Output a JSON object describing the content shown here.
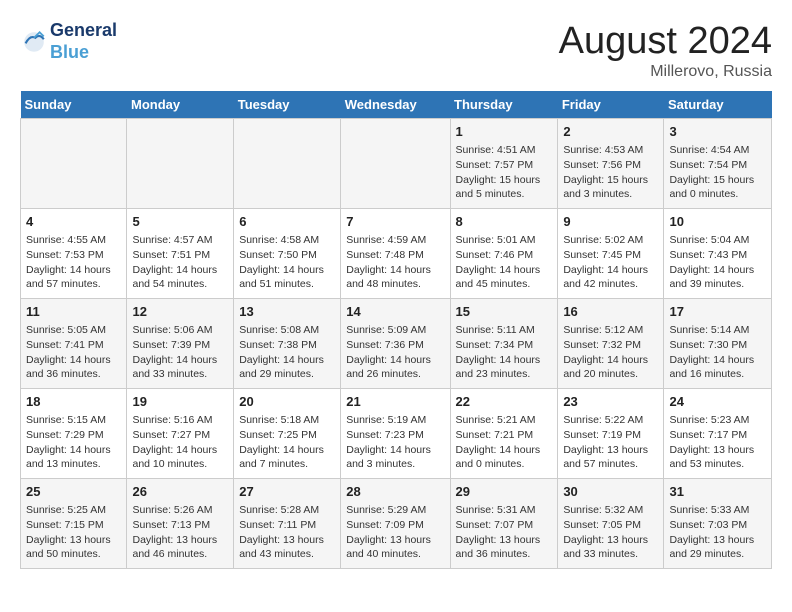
{
  "header": {
    "logo_line1": "General",
    "logo_line2": "Blue",
    "month_year": "August 2024",
    "location": "Millerovo, Russia"
  },
  "weekdays": [
    "Sunday",
    "Monday",
    "Tuesday",
    "Wednesday",
    "Thursday",
    "Friday",
    "Saturday"
  ],
  "weeks": [
    [
      {
        "day": "",
        "info": ""
      },
      {
        "day": "",
        "info": ""
      },
      {
        "day": "",
        "info": ""
      },
      {
        "day": "",
        "info": ""
      },
      {
        "day": "1",
        "info": "Sunrise: 4:51 AM\nSunset: 7:57 PM\nDaylight: 15 hours\nand 5 minutes."
      },
      {
        "day": "2",
        "info": "Sunrise: 4:53 AM\nSunset: 7:56 PM\nDaylight: 15 hours\nand 3 minutes."
      },
      {
        "day": "3",
        "info": "Sunrise: 4:54 AM\nSunset: 7:54 PM\nDaylight: 15 hours\nand 0 minutes."
      }
    ],
    [
      {
        "day": "4",
        "info": "Sunrise: 4:55 AM\nSunset: 7:53 PM\nDaylight: 14 hours\nand 57 minutes."
      },
      {
        "day": "5",
        "info": "Sunrise: 4:57 AM\nSunset: 7:51 PM\nDaylight: 14 hours\nand 54 minutes."
      },
      {
        "day": "6",
        "info": "Sunrise: 4:58 AM\nSunset: 7:50 PM\nDaylight: 14 hours\nand 51 minutes."
      },
      {
        "day": "7",
        "info": "Sunrise: 4:59 AM\nSunset: 7:48 PM\nDaylight: 14 hours\nand 48 minutes."
      },
      {
        "day": "8",
        "info": "Sunrise: 5:01 AM\nSunset: 7:46 PM\nDaylight: 14 hours\nand 45 minutes."
      },
      {
        "day": "9",
        "info": "Sunrise: 5:02 AM\nSunset: 7:45 PM\nDaylight: 14 hours\nand 42 minutes."
      },
      {
        "day": "10",
        "info": "Sunrise: 5:04 AM\nSunset: 7:43 PM\nDaylight: 14 hours\nand 39 minutes."
      }
    ],
    [
      {
        "day": "11",
        "info": "Sunrise: 5:05 AM\nSunset: 7:41 PM\nDaylight: 14 hours\nand 36 minutes."
      },
      {
        "day": "12",
        "info": "Sunrise: 5:06 AM\nSunset: 7:39 PM\nDaylight: 14 hours\nand 33 minutes."
      },
      {
        "day": "13",
        "info": "Sunrise: 5:08 AM\nSunset: 7:38 PM\nDaylight: 14 hours\nand 29 minutes."
      },
      {
        "day": "14",
        "info": "Sunrise: 5:09 AM\nSunset: 7:36 PM\nDaylight: 14 hours\nand 26 minutes."
      },
      {
        "day": "15",
        "info": "Sunrise: 5:11 AM\nSunset: 7:34 PM\nDaylight: 14 hours\nand 23 minutes."
      },
      {
        "day": "16",
        "info": "Sunrise: 5:12 AM\nSunset: 7:32 PM\nDaylight: 14 hours\nand 20 minutes."
      },
      {
        "day": "17",
        "info": "Sunrise: 5:14 AM\nSunset: 7:30 PM\nDaylight: 14 hours\nand 16 minutes."
      }
    ],
    [
      {
        "day": "18",
        "info": "Sunrise: 5:15 AM\nSunset: 7:29 PM\nDaylight: 14 hours\nand 13 minutes."
      },
      {
        "day": "19",
        "info": "Sunrise: 5:16 AM\nSunset: 7:27 PM\nDaylight: 14 hours\nand 10 minutes."
      },
      {
        "day": "20",
        "info": "Sunrise: 5:18 AM\nSunset: 7:25 PM\nDaylight: 14 hours\nand 7 minutes."
      },
      {
        "day": "21",
        "info": "Sunrise: 5:19 AM\nSunset: 7:23 PM\nDaylight: 14 hours\nand 3 minutes."
      },
      {
        "day": "22",
        "info": "Sunrise: 5:21 AM\nSunset: 7:21 PM\nDaylight: 14 hours\nand 0 minutes."
      },
      {
        "day": "23",
        "info": "Sunrise: 5:22 AM\nSunset: 7:19 PM\nDaylight: 13 hours\nand 57 minutes."
      },
      {
        "day": "24",
        "info": "Sunrise: 5:23 AM\nSunset: 7:17 PM\nDaylight: 13 hours\nand 53 minutes."
      }
    ],
    [
      {
        "day": "25",
        "info": "Sunrise: 5:25 AM\nSunset: 7:15 PM\nDaylight: 13 hours\nand 50 minutes."
      },
      {
        "day": "26",
        "info": "Sunrise: 5:26 AM\nSunset: 7:13 PM\nDaylight: 13 hours\nand 46 minutes."
      },
      {
        "day": "27",
        "info": "Sunrise: 5:28 AM\nSunset: 7:11 PM\nDaylight: 13 hours\nand 43 minutes."
      },
      {
        "day": "28",
        "info": "Sunrise: 5:29 AM\nSunset: 7:09 PM\nDaylight: 13 hours\nand 40 minutes."
      },
      {
        "day": "29",
        "info": "Sunrise: 5:31 AM\nSunset: 7:07 PM\nDaylight: 13 hours\nand 36 minutes."
      },
      {
        "day": "30",
        "info": "Sunrise: 5:32 AM\nSunset: 7:05 PM\nDaylight: 13 hours\nand 33 minutes."
      },
      {
        "day": "31",
        "info": "Sunrise: 5:33 AM\nSunset: 7:03 PM\nDaylight: 13 hours\nand 29 minutes."
      }
    ]
  ]
}
